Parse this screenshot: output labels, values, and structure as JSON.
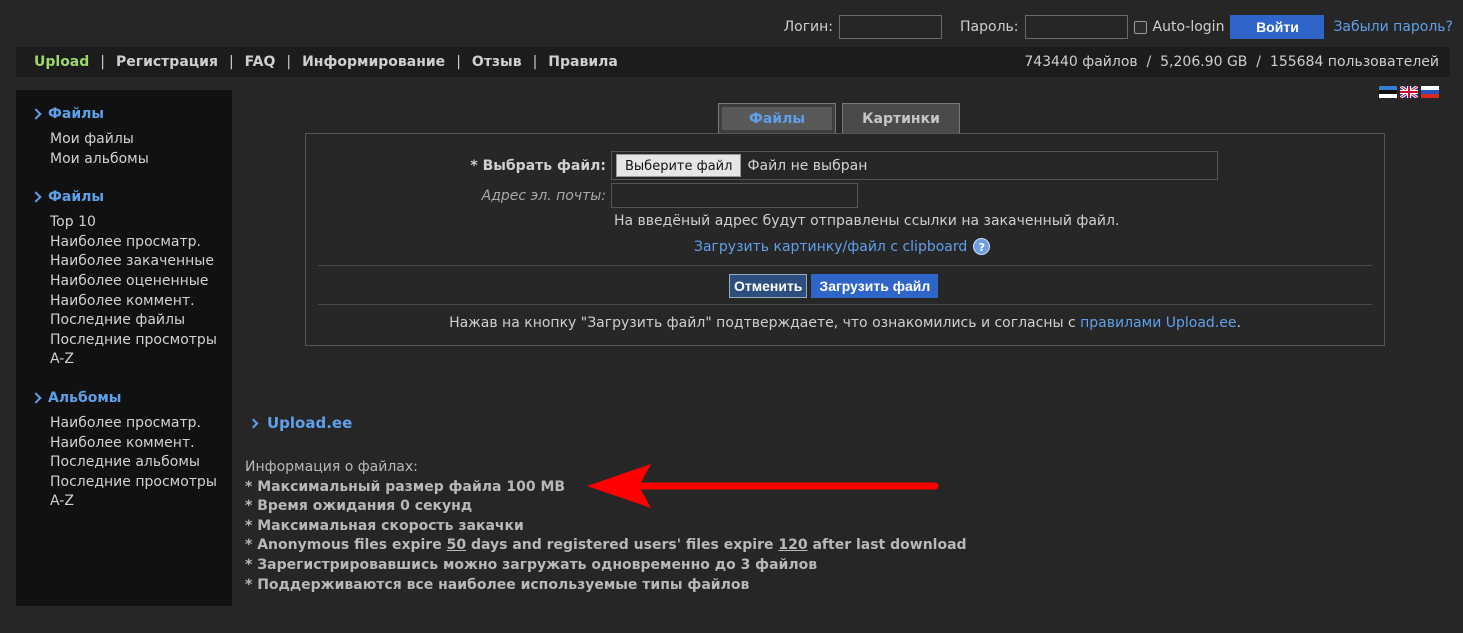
{
  "login": {
    "login_label": "Логин:",
    "password_label": "Пароль:",
    "autologin_label": "Auto-login",
    "submit_label": "Войти",
    "forgot_label": "Забыли пароль?"
  },
  "nav": {
    "items": [
      "Upload",
      "Регистрация",
      "FAQ",
      "Информирование",
      "Отзыв",
      "Правила"
    ],
    "separator": "|",
    "stats": "743440 файлов  /  5,206.90 GB  /  155684 пользователей"
  },
  "flags": [
    "estonian-flag",
    "uk-flag",
    "russian-flag"
  ],
  "sidebar": {
    "sections": [
      {
        "title": "Файлы",
        "items": [
          "Мои файлы",
          "Мои альбомы"
        ]
      },
      {
        "title": "Файлы",
        "items": [
          "Top 10",
          "Наиболее просматр.",
          "Наиболее закаченные",
          "Наиболее оцененные",
          "Наиболее коммент.",
          "Последние файлы",
          "Последние просмотры",
          "A-Z"
        ]
      },
      {
        "title": "Альбомы",
        "items": [
          "Наиболее просматр.",
          "Наиболее коммент.",
          "Последние альбомы",
          "Последние просмотры",
          "A-Z"
        ]
      }
    ]
  },
  "upload": {
    "tabs": [
      "Файлы",
      "Картинки"
    ],
    "file_label": "* Выбрать файл:",
    "file_button": "Выберите файл",
    "file_status": "Файл не выбран",
    "email_label": "Адрес эл. почты:",
    "email_note": "На введёный адрес будут отправлены ссылки на закаченный файл.",
    "clipboard_link": "Загрузить картинку/файл с clipboard",
    "help_icon": "?",
    "cancel_label": "Отменить",
    "upload_label": "Загрузить файл",
    "agree_text": "Нажав на кнопку \"Загрузить файл\" подтверждаете, что ознакомились и согласны с ",
    "agree_link": "правилами Upload.ee",
    "agree_end": "."
  },
  "info": {
    "heading": "Upload.ee",
    "intro": "Информация о файлах:",
    "max_size": "* Максимальный размер файла 100 MB",
    "wait": "* Время ожидания 0 секунд",
    "speed": "* Максимальная скорость закачки",
    "expire_a": "* Anonymous files expire ",
    "expire_days": "50",
    "expire_b": " days and registered users' files expire ",
    "expire_reg": "120",
    "expire_c": " after last download",
    "simul": "* Зарегистрировавшись можно загружать одновременно до 3 файлов",
    "types": "* Поддерживаются все наиболее используемые типы файлов"
  },
  "colors": {
    "accent": "#5fa0ea",
    "active_nav": "#9fd86a",
    "button": "#2f65c8",
    "arrow": "#ff0000"
  }
}
